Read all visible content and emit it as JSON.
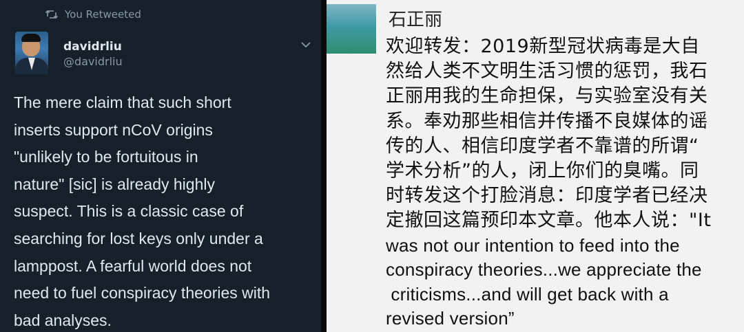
{
  "tweet": {
    "retweet_label": "You Retweeted",
    "user_name": "davidrliu",
    "handle": "@davidrliu",
    "lines": [
      "The mere claim that such short",
      "inserts support nCoV origins",
      "\"unlikely to be fortuitous in",
      "nature\" [sic] is already highly",
      "suspect. This is a classic case of",
      "searching for lost keys only under a",
      "lamppost. A fearful world does not",
      "need to fuel conspiracy theories with",
      "bad analyses."
    ]
  },
  "weibo": {
    "user_name": "石正丽",
    "lines_cn": [
      "欢迎转发：2019新型冠状病毒是大自",
      "然给人类不文明生活习惯的惩罚，我石",
      "正丽用我的生命担保，与实验室没有关",
      "系。奉劝那些相信并传播不良媒体的谣",
      "传的人、相信印度学者不靠谱的所谓“",
      "学术分析”的人，闭上你们的臭嘴。同",
      "时转发这个打脸消息：印度学者已经决",
      "定撤回这篇预印本文章。他本人说：\"It"
    ],
    "lines_en": [
      "was not our intention to feed into the",
      "conspiracy theories...we appreciate the",
      " criticisms...and will get back with a",
      "revised version”"
    ]
  },
  "colors": {
    "twitter_bg": "#15202b",
    "twitter_text": "#e1e8ed",
    "twitter_muted": "#8899a6",
    "weibo_bg": "#f2f2f2",
    "weibo_text": "#111111"
  },
  "icons": {
    "retweet": "retweet-icon",
    "menu": "chevron-down-icon"
  }
}
